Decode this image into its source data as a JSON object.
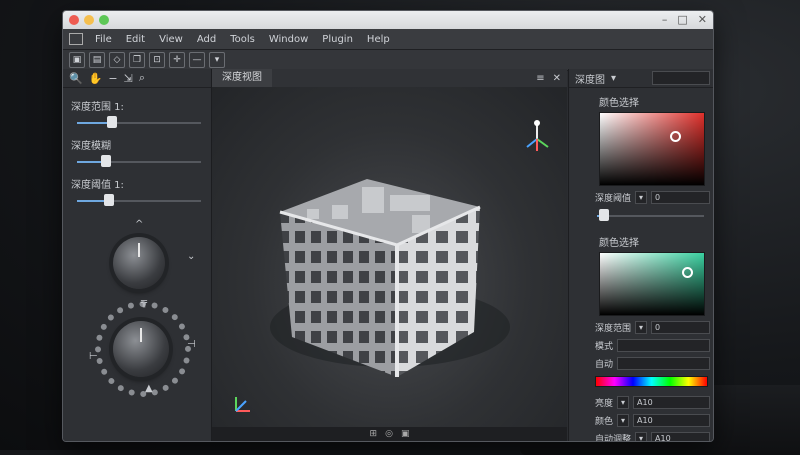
{
  "menu": {
    "items": [
      "File",
      "Edit",
      "View",
      "Add",
      "Tools",
      "Window",
      "Plugin",
      "Help"
    ]
  },
  "left_panel": {
    "sliders": [
      {
        "label": "深度范围 1:",
        "value": 0.3
      },
      {
        "label": "深度模糊",
        "value": 0.25
      },
      {
        "label": "深度阈值 1:",
        "value": 0.28
      }
    ]
  },
  "viewport": {
    "tab_label": "深度视图"
  },
  "right_panel": {
    "header_label": "深度图",
    "section1_title": "颜色选择",
    "field1_label": "深度阈值",
    "field1_value": "0",
    "section2_title": "颜色选择",
    "field2_label": "深度范围",
    "field2_value": "0",
    "row_a": "模式",
    "row_b": "自动",
    "prop1_label": "亮度",
    "prop1_value": "A10",
    "prop2_label": "颜色",
    "prop2_value": "A10",
    "prop3_label": "自动调整",
    "prop3_value": "A10"
  },
  "colors": {
    "accent": "#6fa8e0",
    "panel": "#2e3034",
    "viewport": "#242629"
  }
}
